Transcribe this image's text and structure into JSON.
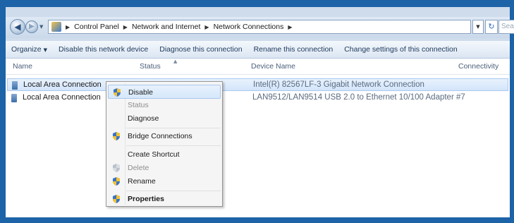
{
  "address_bar": {
    "crumbs": [
      "Control Panel",
      "Network and Internet",
      "Network Connections"
    ],
    "search_placeholder": "Search"
  },
  "command_bar": {
    "organize_label": "Organize",
    "disable_label": "Disable this network device",
    "diagnose_label": "Diagnose this connection",
    "rename_label": "Rename this connection",
    "change_settings_label": "Change settings of this connection"
  },
  "columns": {
    "name": "Name",
    "status": "Status",
    "device_name": "Device Name",
    "connectivity": "Connectivity"
  },
  "connections": [
    {
      "name": "Local Area Connection",
      "device": "Intel(R) 82567LF-3 Gigabit Network Connection",
      "selected": true
    },
    {
      "name": "Local Area Connection",
      "device": "LAN9512/LAN9514 USB 2.0 to Ethernet 10/100 Adapter #7",
      "selected": false
    }
  ],
  "context_menu": {
    "items": [
      {
        "label": "Disable",
        "icon": "shield-icon",
        "highlighted": true
      },
      {
        "label": "Status",
        "disabled": true
      },
      {
        "label": "Diagnose"
      },
      {
        "label": "Bridge Connections",
        "icon": "shield-icon"
      },
      {
        "label": "Create Shortcut"
      },
      {
        "label": "Delete",
        "icon": "shield-icon",
        "disabled": true
      },
      {
        "label": "Rename",
        "icon": "shield-icon"
      },
      {
        "label": "Properties",
        "icon": "shield-icon",
        "bold": true
      }
    ]
  },
  "colors": {
    "window_border": "#1d63a8",
    "selection": "#d3e5fb",
    "shield_blue": "#3a73c4",
    "shield_yellow": "#f2c230"
  }
}
